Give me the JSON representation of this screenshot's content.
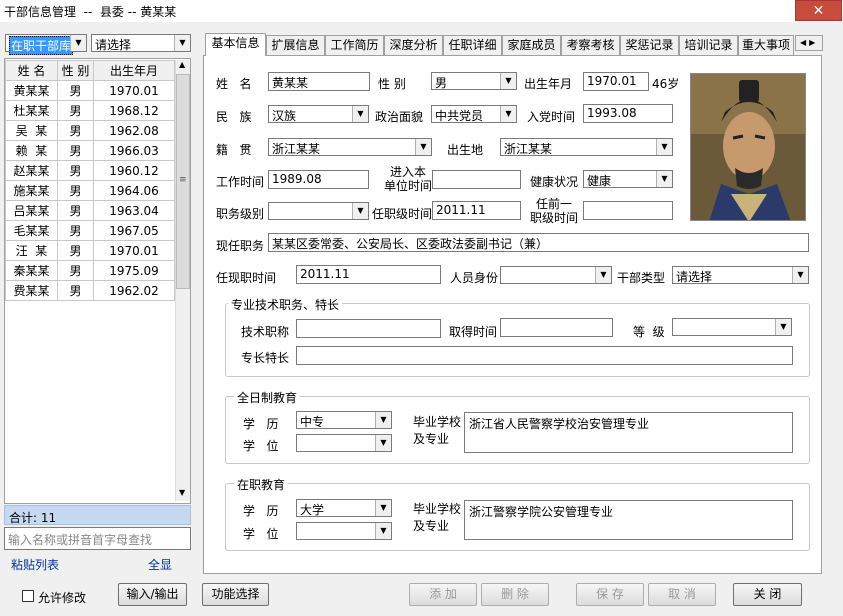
{
  "window": {
    "title": "干部信息管理  --  县委 -- 黄某某",
    "close_glyph": "✕"
  },
  "left_panel": {
    "filter1": "在职干部库",
    "filter2": "请选择",
    "columns": [
      "姓 名",
      "性 别",
      "出生年月"
    ],
    "rows": [
      {
        "name": "黄某某",
        "gender": "男",
        "birth": "1970.01"
      },
      {
        "name": "杜某某",
        "gender": "男",
        "birth": "1968.12"
      },
      {
        "name": "吴  某",
        "gender": "男",
        "birth": "1962.08"
      },
      {
        "name": "赖  某",
        "gender": "男",
        "birth": "1966.03"
      },
      {
        "name": "赵某某",
        "gender": "男",
        "birth": "1960.12"
      },
      {
        "name": "施某某",
        "gender": "男",
        "birth": "1964.06"
      },
      {
        "name": "吕某某",
        "gender": "男",
        "birth": "1963.04"
      },
      {
        "name": "毛某某",
        "gender": "男",
        "birth": "1967.05"
      },
      {
        "name": "汪  某",
        "gender": "男",
        "birth": "1970.01"
      },
      {
        "name": "秦某某",
        "gender": "男",
        "birth": "1975.09"
      },
      {
        "name": "费某某",
        "gender": "男",
        "birth": "1962.02"
      }
    ],
    "total_label": "合计: 11",
    "search_placeholder": "输入名称或拼音首字母查找",
    "paste_list": "粘贴列表",
    "show_all": "全显"
  },
  "tabs": [
    "基本信息",
    "扩展信息",
    "工作简历",
    "深度分析",
    "任职详细",
    "家庭成员",
    "考察考核",
    "奖惩记录",
    "培训记录",
    "重大事项"
  ],
  "form": {
    "name_label": "姓   名",
    "name": "黄某某",
    "gender_label": "性 别",
    "gender": "男",
    "birth_label": "出生年月",
    "birth": "1970.01",
    "age": "46岁",
    "ethnic_label": "民   族",
    "ethnic": "汉族",
    "political_label": "政治面貌",
    "political": "中共党员",
    "party_label": "入党时间",
    "party_date": "1993.08",
    "origin_label": "籍   贯",
    "origin": "浙江某某",
    "birthplace_label": "出生地",
    "birthplace": "浙江某某",
    "work_label": "工作时间",
    "work_date": "1989.08",
    "unit_label": "进入本\n单位时间",
    "unit_date": "",
    "health_label": "健康状况",
    "health": "健康",
    "level_label": "职务级别",
    "level": "",
    "level_time_label": "任职级时间",
    "level_time": "2011.11",
    "prev_label": "任前一\n职级时间",
    "prev_time": "",
    "current_post_label": "现任职务",
    "current_post": "某某区委常委、公安局长、区委政法委副书记（兼）",
    "post_time_label": "任现职时间",
    "post_time": "2011.11",
    "identity_label": "人员身份",
    "identity": "",
    "cadre_type_label": "干部类型",
    "cadre_type": "请选择"
  },
  "specialty": {
    "group_title": "专业技术职务、特长",
    "title_label": "技术职称",
    "title_value": "",
    "obtain_label": "取得时间",
    "obtain_value": "",
    "grade_label": "等  级",
    "grade_value": "",
    "skill_label": "专长特长",
    "skill_value": ""
  },
  "fulltime_edu": {
    "group_title": "全日制教育",
    "degree_label": "学   历",
    "degree": "中专",
    "diploma_label": "学   位",
    "diploma": "",
    "school_label": "毕业学校\n及专业",
    "school": "浙江省人民警察学校治安管理专业"
  },
  "inservice_edu": {
    "group_title": "在职教育",
    "degree_label": "学   历",
    "degree": "大学",
    "diploma_label": "学   位",
    "diploma": "",
    "school_label": "毕业学校\n及专业",
    "school": "浙江警察学院公安管理专业"
  },
  "bottom": {
    "allow_edit": "允许修改",
    "io_button": "输入/输出",
    "func_button": "功能选择",
    "add": "添 加",
    "delete": "删 除",
    "save": "保 存",
    "cancel": "取 消",
    "close": "关 闭"
  },
  "colors": {
    "selected_filter_bg": "#3399ff",
    "total_bar_bg": "#c5d9f1",
    "close_red": "#c74c3c"
  }
}
